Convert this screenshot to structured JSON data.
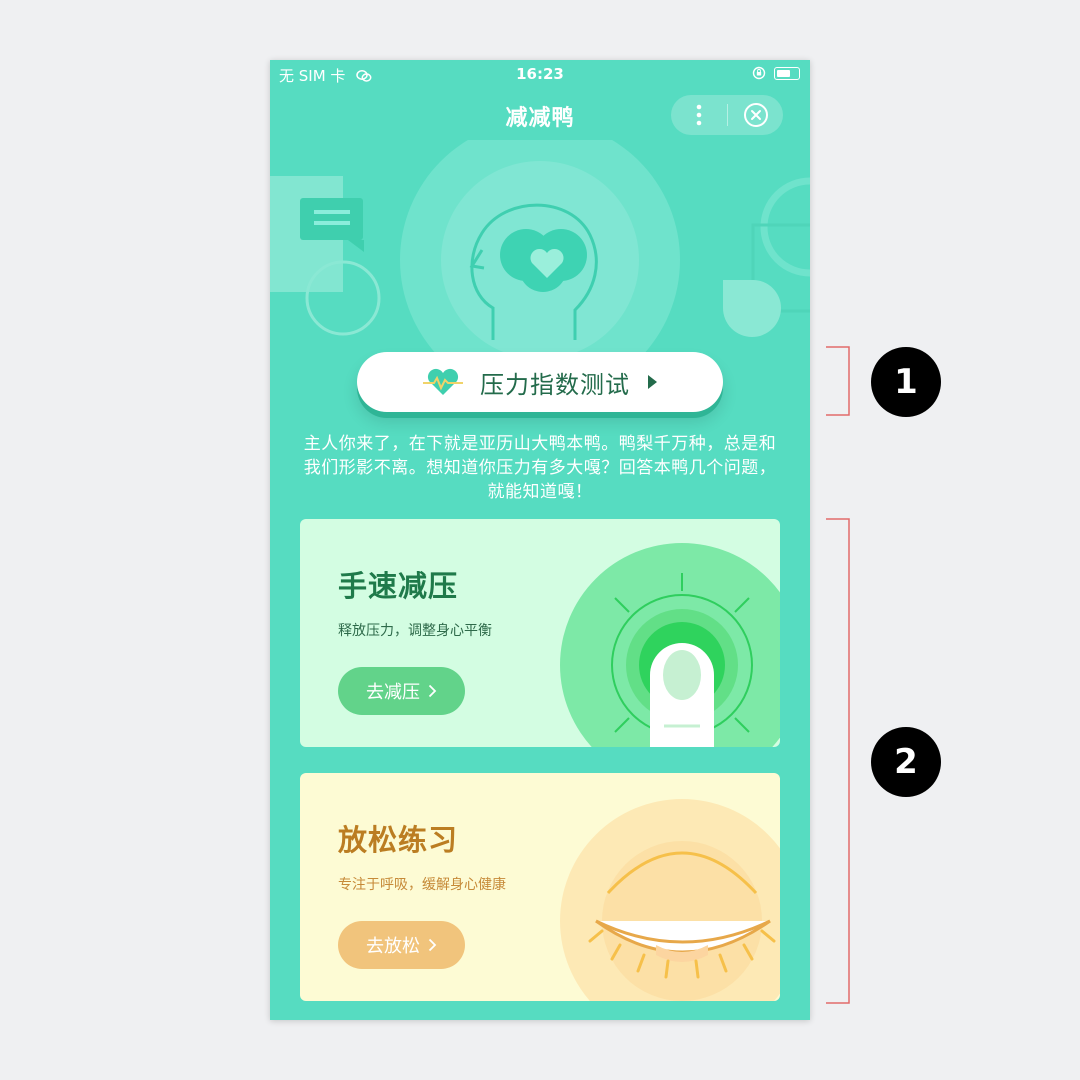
{
  "status_bar": {
    "carrier": "无 SIM 卡",
    "time": "16:23"
  },
  "header": {
    "title": "减减鸭"
  },
  "hero": {
    "test_button_label": "压力指数测试",
    "intro_text": "主人你来了，在下就是亚历山大鸭本鸭。鸭梨千万种，总是和我们形影不离。想知道你压力有多大嘎？回答本鸭几个问题，就能知道嘎！"
  },
  "cards": [
    {
      "title": "手速减压",
      "subtitle": "释放压力，调整身心平衡",
      "button_label": "去减压"
    },
    {
      "title": "放松练习",
      "subtitle": "专注于呼吸，缓解身心健康",
      "button_label": "去放松"
    }
  ],
  "annotations": [
    "1",
    "2"
  ],
  "colors": {
    "page_bg": "#eff0f2",
    "app_bg": "#56dcc1",
    "green_card": "#d3fde2",
    "yellow_card": "#fdfbd4",
    "green_button": "#62d38a",
    "yellow_button": "#f1c47c",
    "callout_line": "#e26a6a"
  },
  "icons": [
    "wechat-icon",
    "lock-rotation-icon",
    "battery-icon",
    "more-icon",
    "close-icon",
    "heartbeat-icon",
    "play-arrow-icon",
    "chevron-right-icon"
  ]
}
